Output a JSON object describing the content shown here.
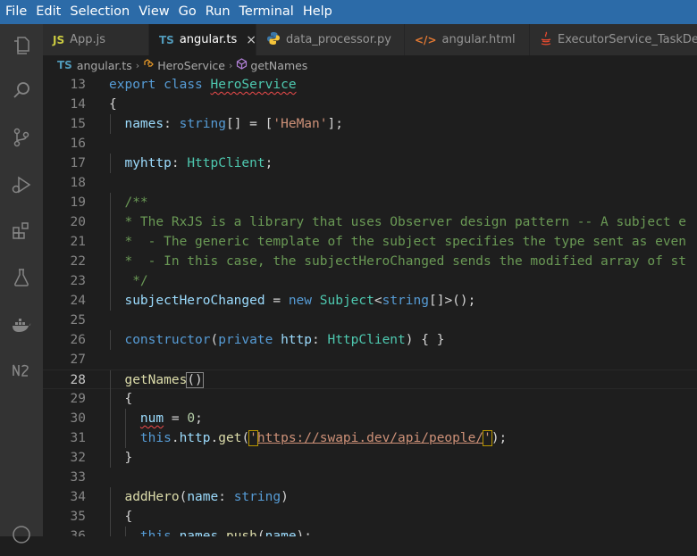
{
  "menu": [
    "File",
    "Edit",
    "Selection",
    "View",
    "Go",
    "Run",
    "Terminal",
    "Help"
  ],
  "tabs": [
    {
      "icon": "JS",
      "label": "App.js"
    },
    {
      "icon": "TS",
      "label": "angular.ts",
      "close": "×"
    },
    {
      "icon": "py",
      "label": "data_processor.py"
    },
    {
      "icon": "</>",
      "label": "angular.html"
    },
    {
      "icon": "java",
      "label": "ExecutorService_TaskDepe"
    }
  ],
  "breadcrumb": {
    "file_icon": "TS",
    "file": "angular.ts",
    "sep": "›",
    "cls": "HeroService",
    "method": "getNames"
  },
  "editor": {
    "lines": [
      {
        "n": "13",
        "segs": [
          [
            "kw",
            "export"
          ],
          [
            "plain",
            " "
          ],
          [
            "kw",
            "class"
          ],
          [
            "plain",
            " "
          ],
          [
            "cls squiggle",
            "HeroService"
          ]
        ]
      },
      {
        "n": "14",
        "segs": [
          [
            "plain",
            "{"
          ]
        ]
      },
      {
        "n": "15",
        "segs": [
          [
            "plain",
            "  "
          ],
          [
            "var",
            "names"
          ],
          [
            "plain",
            ": "
          ],
          [
            "kw",
            "string"
          ],
          [
            "plain",
            "[] = ["
          ],
          [
            "str",
            "'HeMan'"
          ],
          [
            "plain",
            "];"
          ]
        ]
      },
      {
        "n": "16",
        "segs": []
      },
      {
        "n": "17",
        "segs": [
          [
            "plain",
            "  "
          ],
          [
            "var",
            "myhttp"
          ],
          [
            "plain",
            ": "
          ],
          [
            "cls",
            "HttpClient"
          ],
          [
            "plain",
            ";"
          ]
        ]
      },
      {
        "n": "18",
        "segs": []
      },
      {
        "n": "19",
        "segs": [
          [
            "plain",
            "  "
          ],
          [
            "cmt",
            "/**"
          ]
        ]
      },
      {
        "n": "20",
        "segs": [
          [
            "plain",
            "  "
          ],
          [
            "cmt",
            "* The RxJS is a library that uses Observer design pattern -- A subject e"
          ]
        ]
      },
      {
        "n": "21",
        "segs": [
          [
            "plain",
            "  "
          ],
          [
            "cmt",
            "*  - The generic template of the subject specifies the type sent as even"
          ]
        ]
      },
      {
        "n": "22",
        "segs": [
          [
            "plain",
            "  "
          ],
          [
            "cmt",
            "*  - In this case, the subjectHeroChanged sends the modified array of st"
          ]
        ]
      },
      {
        "n": "23",
        "segs": [
          [
            "plain",
            "  "
          ],
          [
            "cmt",
            " */"
          ]
        ]
      },
      {
        "n": "24",
        "segs": [
          [
            "plain",
            "  "
          ],
          [
            "var",
            "subjectHeroChanged"
          ],
          [
            "plain",
            " = "
          ],
          [
            "kw",
            "new"
          ],
          [
            "plain",
            " "
          ],
          [
            "cls",
            "Subject"
          ],
          [
            "plain",
            "<"
          ],
          [
            "kw",
            "string"
          ],
          [
            "plain",
            "[]>();"
          ]
        ]
      },
      {
        "n": "25",
        "segs": []
      },
      {
        "n": "26",
        "segs": [
          [
            "plain",
            "  "
          ],
          [
            "kw",
            "constructor"
          ],
          [
            "plain",
            "("
          ],
          [
            "kw",
            "private"
          ],
          [
            "plain",
            " "
          ],
          [
            "var",
            "http"
          ],
          [
            "plain",
            ": "
          ],
          [
            "cls",
            "HttpClient"
          ],
          [
            "plain",
            ") { }"
          ]
        ]
      },
      {
        "n": "27",
        "segs": []
      },
      {
        "n": "28",
        "segs": [
          [
            "plain",
            "  "
          ],
          [
            "fn",
            "getNames"
          ],
          [
            "plain brk",
            "()"
          ]
        ],
        "current": true
      },
      {
        "n": "29",
        "segs": [
          [
            "plain",
            "  {"
          ]
        ]
      },
      {
        "n": "30",
        "segs": [
          [
            "plain",
            "    "
          ],
          [
            "var squiggle",
            "num"
          ],
          [
            "plain",
            " = "
          ],
          [
            "num",
            "0"
          ],
          [
            "plain",
            ";"
          ]
        ]
      },
      {
        "n": "31",
        "segs": [
          [
            "plain",
            "    "
          ],
          [
            "kw",
            "this"
          ],
          [
            "plain",
            "."
          ],
          [
            "var",
            "http"
          ],
          [
            "plain",
            "."
          ],
          [
            "fn",
            "get"
          ],
          [
            "plain",
            "("
          ],
          [
            "str qbox",
            "'"
          ],
          [
            "str url",
            "https://swapi.dev/api/people/"
          ],
          [
            "str qbox",
            "'"
          ],
          [
            "plain",
            ");"
          ]
        ]
      },
      {
        "n": "32",
        "segs": [
          [
            "plain",
            "  }"
          ]
        ]
      },
      {
        "n": "33",
        "segs": []
      },
      {
        "n": "34",
        "segs": [
          [
            "plain",
            "  "
          ],
          [
            "fn",
            "addHero"
          ],
          [
            "plain",
            "("
          ],
          [
            "var",
            "name"
          ],
          [
            "plain",
            ": "
          ],
          [
            "kw",
            "string"
          ],
          [
            "plain",
            ")"
          ]
        ]
      },
      {
        "n": "35",
        "segs": [
          [
            "plain",
            "  {"
          ]
        ]
      },
      {
        "n": "36",
        "segs": [
          [
            "plain",
            "    "
          ],
          [
            "kw",
            "this"
          ],
          [
            "plain",
            "."
          ],
          [
            "var",
            "names"
          ],
          [
            "plain",
            "."
          ],
          [
            "fn",
            "push"
          ],
          [
            "plain",
            "("
          ],
          [
            "var",
            "name"
          ],
          [
            "plain",
            ");"
          ]
        ]
      }
    ]
  },
  "colors": {
    "menubar": "#2c6ba8",
    "activitybar": "#333333",
    "editor_bg": "#1e1e1e",
    "keyword": "#569cd6",
    "type": "#4ec9b0",
    "function": "#dcdcaa",
    "variable": "#9cdcfe",
    "string": "#ce9178",
    "comment": "#6a9955"
  },
  "activity_icons": [
    "explorer-icon",
    "search-icon",
    "source-control-icon",
    "run-debug-icon",
    "extensions-icon",
    "testing-icon",
    "docker-icon",
    "notebook-icon",
    "account-icon"
  ]
}
